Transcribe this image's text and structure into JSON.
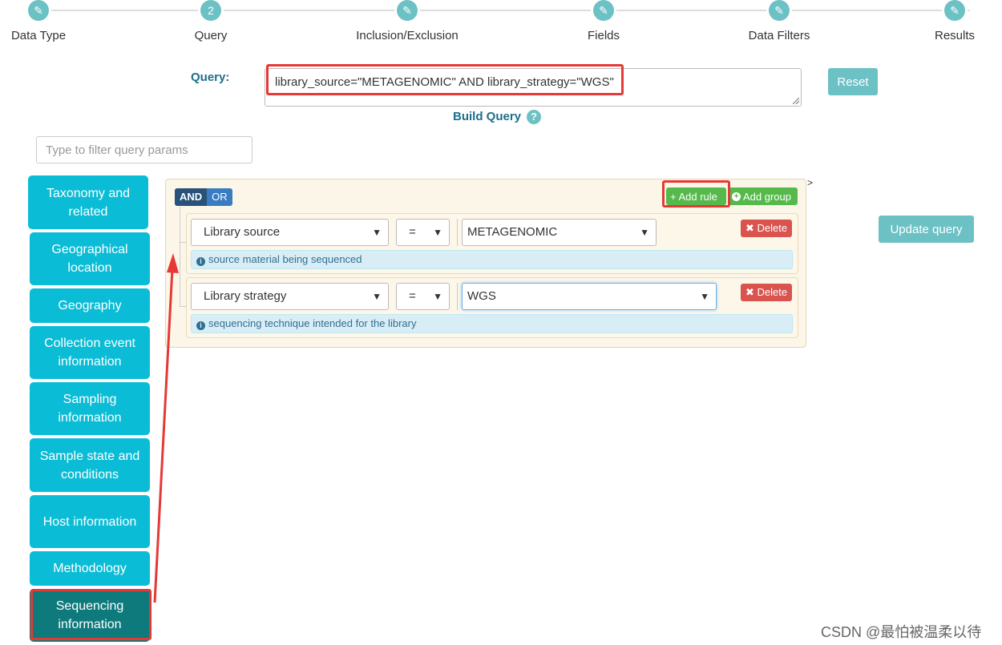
{
  "steps": [
    {
      "label": "Data Type",
      "icon": "pencil-icon",
      "text": "✎"
    },
    {
      "label": "Query",
      "icon": "number-icon",
      "text": "2"
    },
    {
      "label": "Inclusion/Exclusion",
      "icon": "pencil-icon",
      "text": "✎"
    },
    {
      "label": "Fields",
      "icon": "pencil-icon",
      "text": "✎"
    },
    {
      "label": "Data Filters",
      "icon": "pencil-icon",
      "text": "✎"
    },
    {
      "label": "Results",
      "icon": "pencil-icon",
      "text": "✎"
    }
  ],
  "query": {
    "label": "Query:",
    "value": "library_source=\"METAGENOMIC\" AND library_strategy=\"WGS\"",
    "reset_label": "Reset",
    "build_label": "Build Query",
    "help_icon": "question-circle-icon",
    "help_text": "?"
  },
  "filter": {
    "placeholder": "Type to filter query params"
  },
  "sidebar": {
    "items": [
      {
        "label": "Taxonomy and related"
      },
      {
        "label": "Geographical location"
      },
      {
        "label": "Geography"
      },
      {
        "label": "Collection event information"
      },
      {
        "label": "Sampling information"
      },
      {
        "label": "Sample state and conditions"
      },
      {
        "label": "Host information"
      },
      {
        "label": "Methodology"
      },
      {
        "label": "Sequencing information"
      }
    ],
    "active_item": "Sequencing information"
  },
  "builder": {
    "and_label": "AND",
    "or_label": "OR",
    "add_rule_label": "+ Add rule",
    "add_group_label": "Add group",
    "caret": ">",
    "rules": [
      {
        "field": "Library source",
        "operator": "=",
        "value": "METAGENOMIC",
        "hint": "source material being sequenced",
        "delete_label": "✖ Delete"
      },
      {
        "field": "Library strategy",
        "operator": "=",
        "value": "WGS",
        "hint": "sequencing technique intended for the library",
        "delete_label": "✖ Delete"
      }
    ]
  },
  "update_label": "Update query",
  "watermark": "CSDN @最怕被温柔以待",
  "colors": {
    "teal": "#6cc1c4",
    "sidebar": "#0bbcd6",
    "sidebar_active": "#0f7a7c",
    "green": "#55b94b",
    "delete": "#d9534f",
    "highlight": "#e53935"
  }
}
